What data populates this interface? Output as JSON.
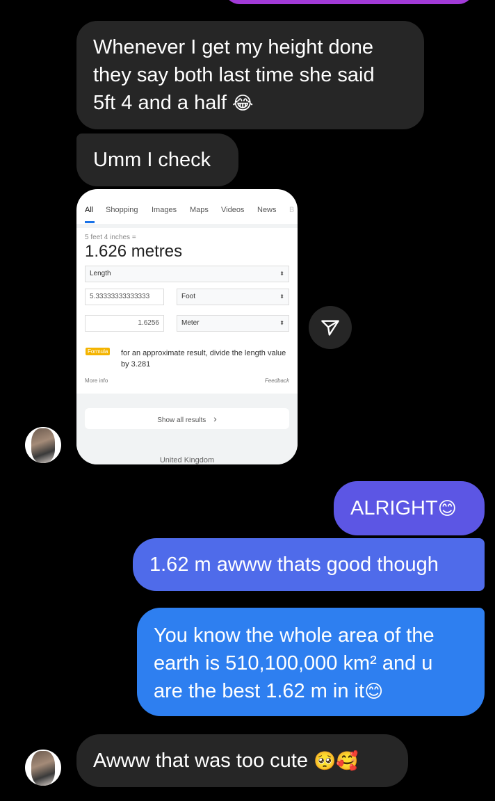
{
  "messages": {
    "in1": {
      "text": "Whenever I get my height done they say both last time she said 5ft 4 and a half",
      "lines": [
        "Whenever I get my height done",
        "they say both last time she said",
        "5ft 4 and a half"
      ],
      "emoji": "😂"
    },
    "in2": {
      "text": "Umm I check"
    },
    "out1": {
      "text": "ALRIGHT",
      "emoji": "😊"
    },
    "out2": {
      "text": "1.62 m awww thats good though"
    },
    "out3": {
      "lines": [
        "You know the whole area of the",
        "earth is 510,100,000  km² and u",
        "are the best 1.62 m in it"
      ],
      "emoji": "😊"
    },
    "in3": {
      "text": "Awww that was too cute",
      "emoji": "🥺🥰"
    }
  },
  "shared_screenshot": {
    "tabs": [
      "All",
      "Shopping",
      "Images",
      "Maps",
      "Videos",
      "News",
      "B"
    ],
    "subtitle": "5 feet 4 inches =",
    "result": "1.626 metres",
    "quantity_select": "Length",
    "from_value": "5.33333333333333",
    "from_unit": "Foot",
    "to_value": "1.6256",
    "to_unit": "Meter",
    "formula_badge": "Formula",
    "formula_text": "for an approximate result, divide the length value by 3.281",
    "more_info": "More info",
    "feedback": "Feedback",
    "show_all": "Show all results",
    "show_all_chevron": "›",
    "region": "United Kingdom"
  },
  "icons": {
    "share": "send-icon",
    "select_arrow": "⬍"
  },
  "colors": {
    "background": "#000000",
    "incoming_bubble": "#262626",
    "outgoing_1": "#5c56e4",
    "outgoing_2": "#4f6bea",
    "outgoing_3": "#2e7ff0",
    "top_bubble": "#a23bd8"
  }
}
